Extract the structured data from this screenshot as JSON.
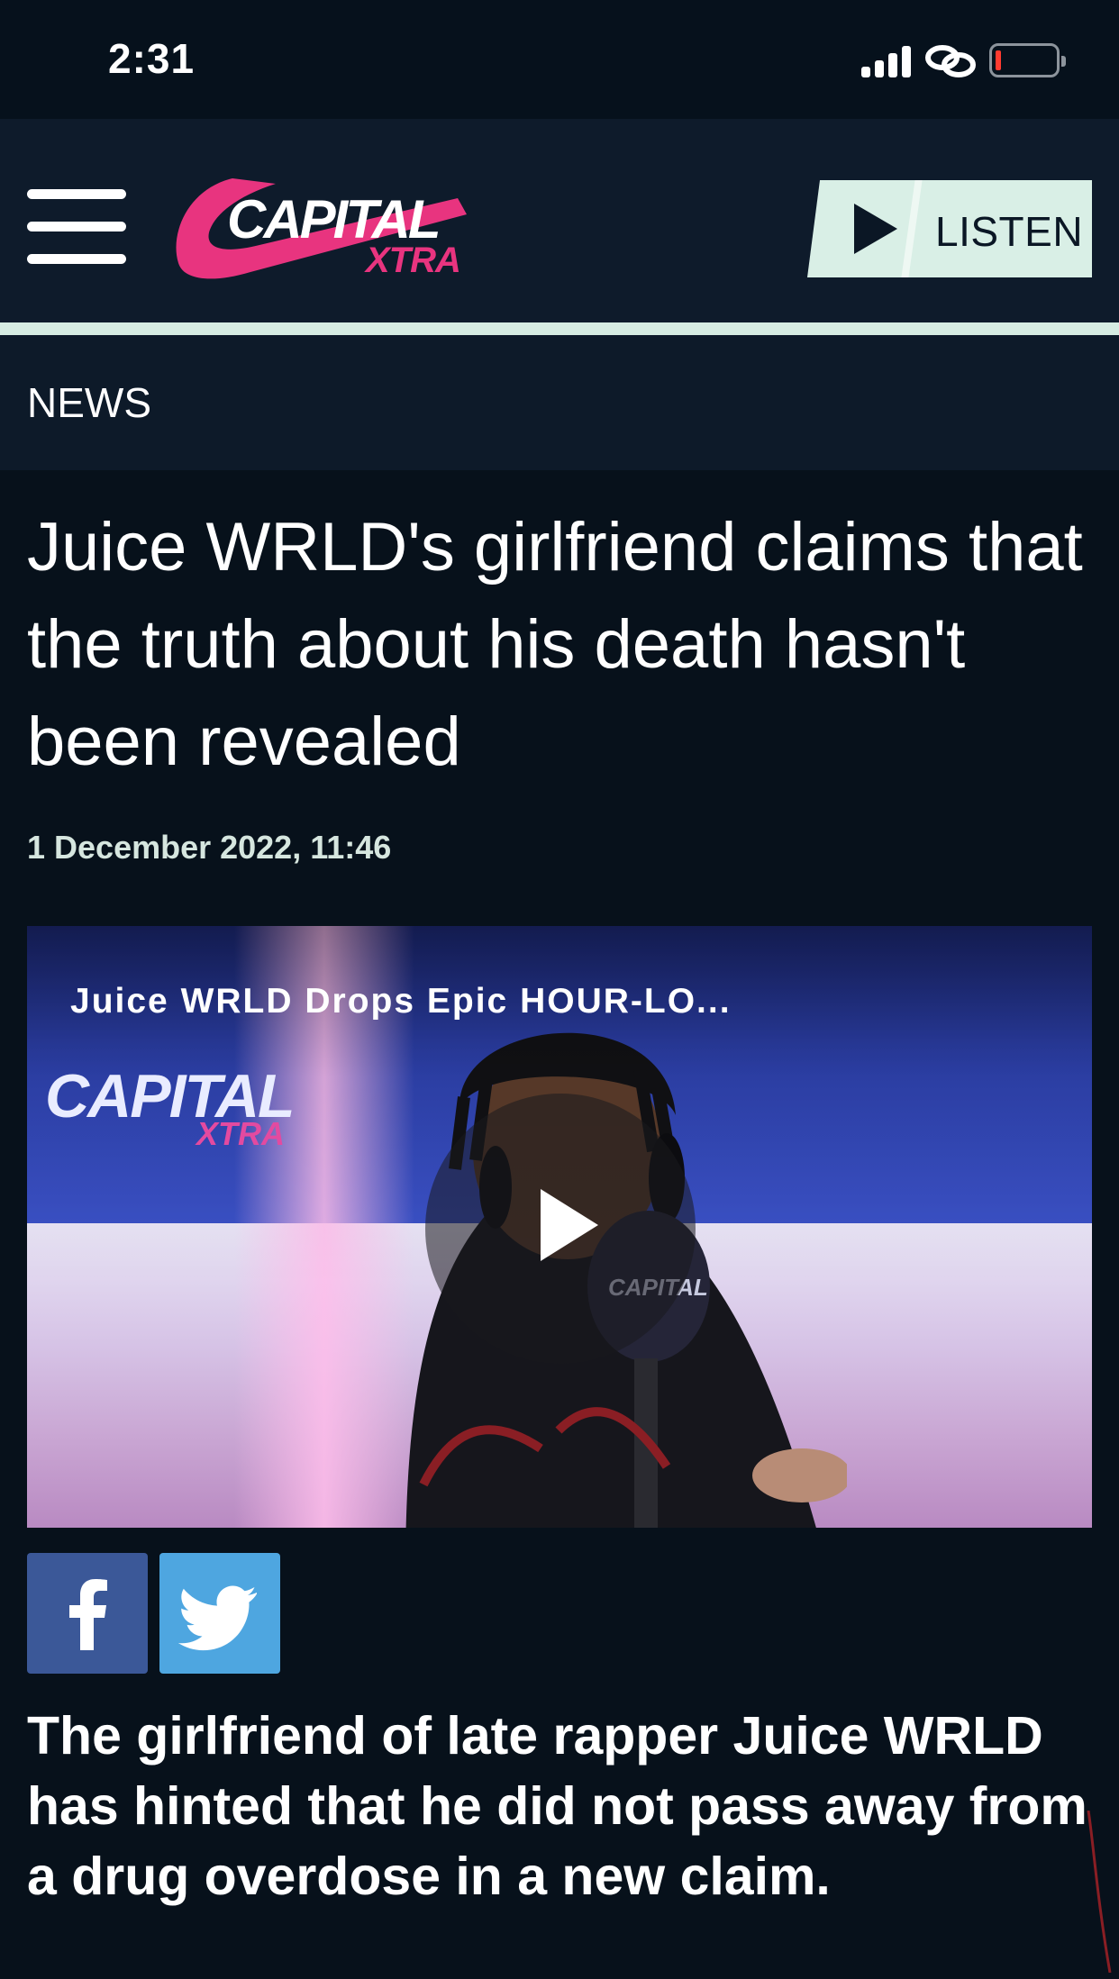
{
  "status_bar": {
    "time": "2:31",
    "icons": [
      "signal-icon",
      "link-icon",
      "battery-icon"
    ],
    "battery_level_percent": 5
  },
  "header": {
    "menu_icon": "hamburger-menu-icon",
    "logo": {
      "word1": "CAPITAL",
      "word2": "XTRA",
      "colors": {
        "primary": "#e8347f",
        "text": "#ffffff"
      }
    },
    "listen_button": {
      "label": "LISTEN",
      "icon": "play-icon",
      "bg_color": "#d9efe6"
    }
  },
  "section": {
    "label": "NEWS"
  },
  "article": {
    "headline": "Juice WRLD's girlfriend claims that the truth about his death hasn't been revealed",
    "date": "1 December 2022, 11:46",
    "video": {
      "title": "Juice WRLD Drops Epic HOUR-LO...",
      "logo_word1": "CAPITAL",
      "logo_word2": "XTRA",
      "play_icon": "play-icon"
    },
    "share": {
      "facebook": {
        "icon": "facebook-icon",
        "color": "#3b5898"
      },
      "twitter": {
        "icon": "twitter-icon",
        "color": "#4ea6e0"
      }
    },
    "lede": "The girlfriend of late rapper Juice WRLD has hinted that he did not pass away from a drug overdose in a new claim."
  },
  "colors": {
    "background": "#07111b",
    "header_bg": "#0e1b2b",
    "accent_mint": "#d6ece2",
    "date_text": "#d6e6df"
  }
}
